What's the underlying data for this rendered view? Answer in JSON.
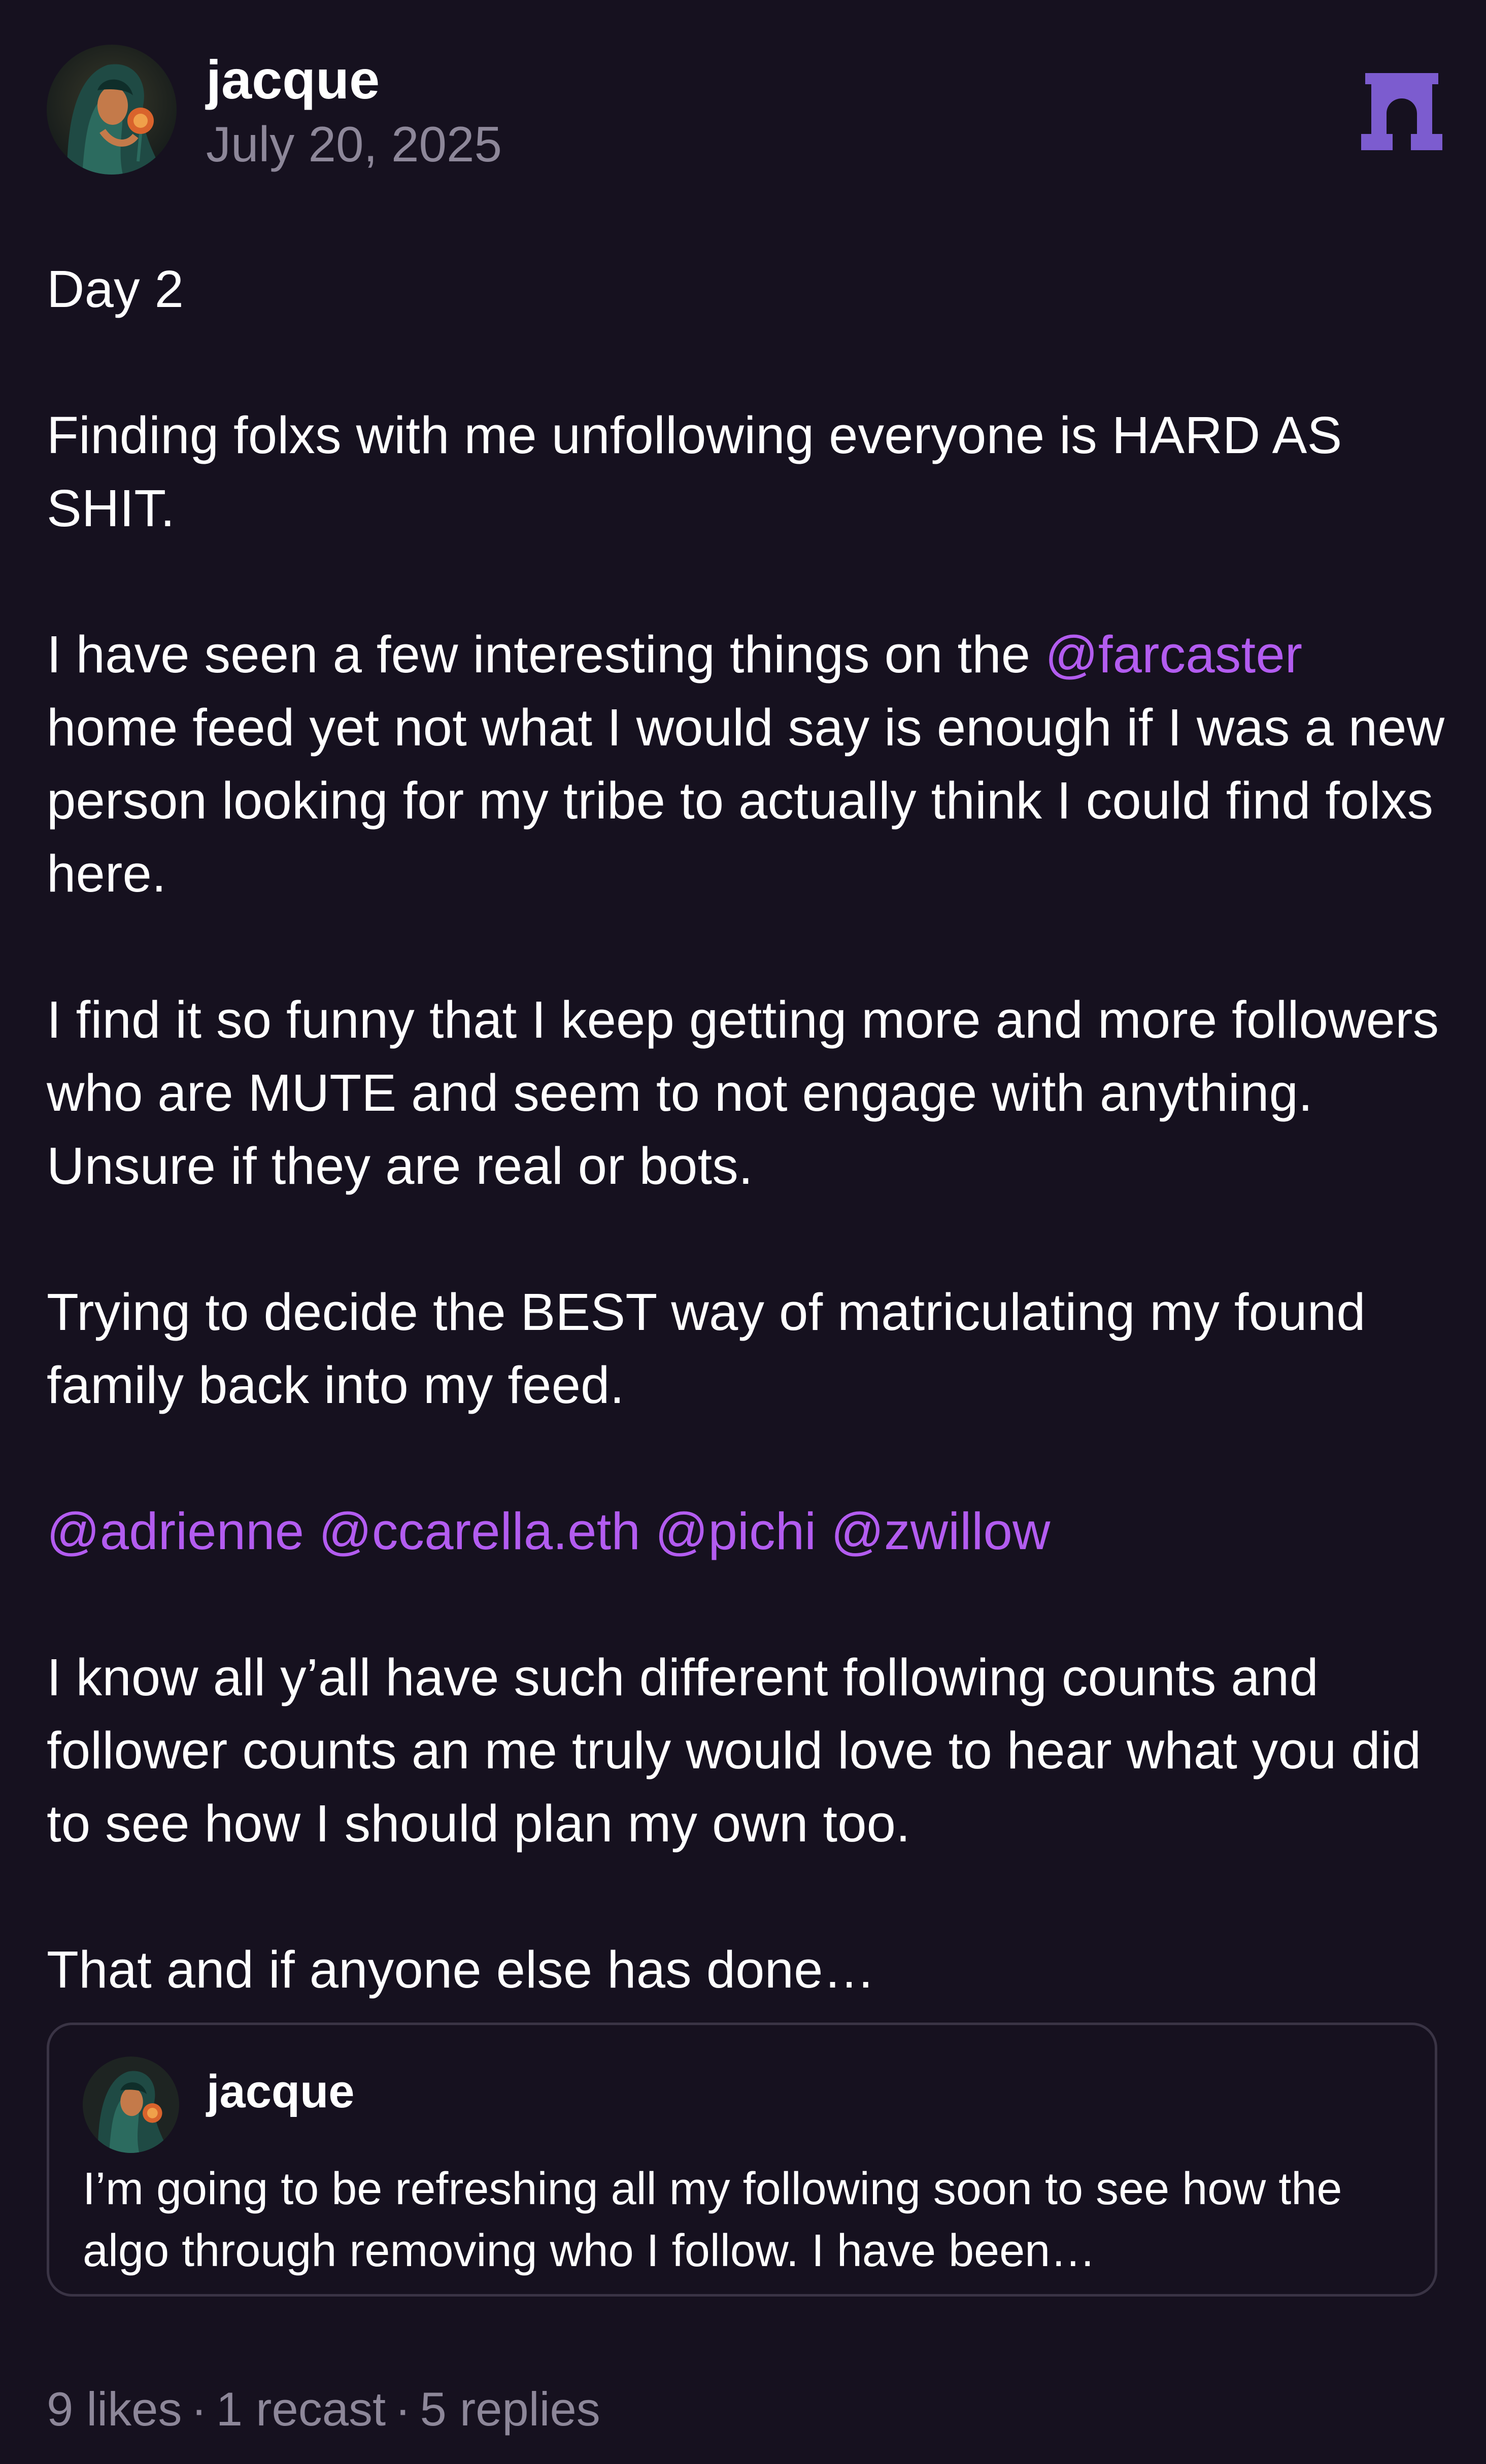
{
  "author": {
    "name": "jacque",
    "date": "July 20, 2025"
  },
  "icons": {
    "avatar": "avatar-illustration",
    "channel": "arch-icon"
  },
  "colors": {
    "background": "#16111f",
    "mention": "#b35cf0",
    "muted": "#8d8799",
    "arch_icon": "#7c5ccf"
  },
  "post": {
    "p1": "Day 2",
    "p2": "Finding folxs with me unfollowing everyone is HARD AS SHIT.",
    "p3_before": "I have seen a few interesting things on the ",
    "p3_mention": "@farcaster",
    "p3_after": " home feed yet not what I would say is enough if I was a new person looking for my tribe to actually think I could find folxs here.",
    "p4": "I find it so funny that I keep getting more and more followers who are MUTE and seem to not engage with anything. Unsure if they are real or bots.",
    "p5": "Trying to decide the BEST way of matriculating my found family back into my feed.",
    "mentions": [
      "@adrienne",
      "@ccarella.eth",
      "@pichi",
      "@zwillow"
    ],
    "p7": "I know all y’all have such different following counts and follower counts an me truly would love to hear what you did to see how I should plan my own too.",
    "p8": "That and if anyone else has done…"
  },
  "quote": {
    "name": "jacque",
    "text": "I’m going to be refreshing all my following soon to see how the algo through removing who I follow. I have been…"
  },
  "stats": {
    "likes": "9 likes",
    "recasts": "1 recast",
    "replies": "5 replies",
    "separator": "·"
  }
}
